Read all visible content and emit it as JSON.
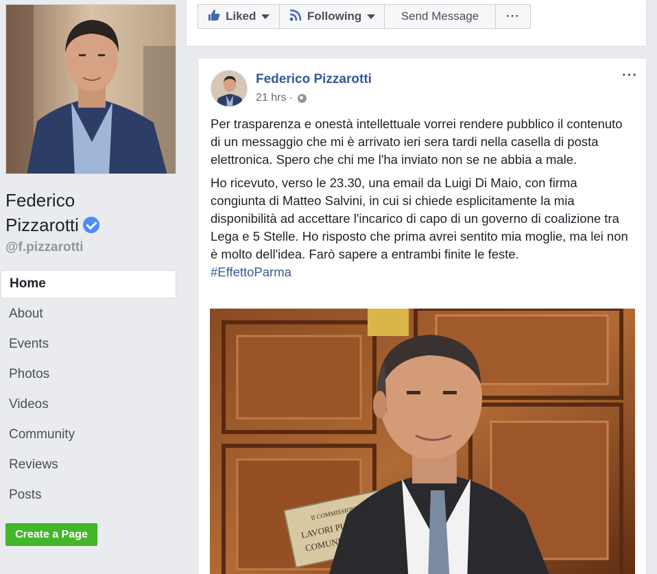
{
  "sidebar": {
    "page_name_line1": "Federico",
    "page_name_line2": "Pizzarotti",
    "username": "@f.pizzarotti",
    "nav": [
      {
        "label": "Home"
      },
      {
        "label": "About"
      },
      {
        "label": "Events"
      },
      {
        "label": "Photos"
      },
      {
        "label": "Videos"
      },
      {
        "label": "Community"
      },
      {
        "label": "Reviews"
      },
      {
        "label": "Posts"
      }
    ],
    "create_page_label": "Create a Page"
  },
  "actions": {
    "liked": "Liked",
    "following": "Following",
    "send_message": "Send Message",
    "more": "···"
  },
  "post": {
    "author": "Federico Pizzarotti",
    "time": "21 hrs",
    "separator": "·",
    "options": "···",
    "paragraph1": "Per trasparenza e onestà intellettuale vorrei rendere pubblico il contenuto di un messaggio che mi è arrivato ieri sera tardi nella casella di posta elettronica. Spero che chi me l'ha inviato non se ne abbia a male.",
    "paragraph2": "Ho ricevuto, verso le 23.30, una email da Luigi Di Maio, con firma congiunta di Matteo Salvini, in cui si chiede esplicitamente la mia disponibilità ad accettare l'incarico di capo di un governo di coalizione tra Lega e 5 Stelle. Ho risposto che prima avrei sentito mia moglie, ma lei non è molto dell'idea. Farò sapere a entrambi finite le feste.",
    "hashtag": "#EffettoParma",
    "photo_plaque_line1": "II COMMISSIONE",
    "photo_plaque_line2": "LAVORI PUBBLICI",
    "photo_plaque_line3": "COMUNICAZIONI"
  },
  "colors": {
    "link": "#365899",
    "green_button": "#42b72a",
    "verified": "#4d8bf5"
  },
  "icons": [
    "thumbs-up-icon",
    "rss-icon",
    "caret-down-icon",
    "verified-badge-icon",
    "globe-icon",
    "more-icon"
  ]
}
